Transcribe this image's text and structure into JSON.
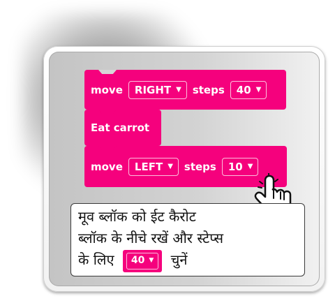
{
  "blocks": [
    {
      "keyword": "move",
      "direction": "RIGHT",
      "steps_label": "steps",
      "steps_value": "40"
    },
    {
      "action": "Eat carrot"
    },
    {
      "keyword": "move",
      "direction": "LEFT",
      "steps_label": "steps",
      "steps_value": "10"
    }
  ],
  "caret_glyph": "▼",
  "instruction": {
    "line1": "मूव ब्लॉक को ईट कैरोट",
    "line2": "ब्लॉक के नीचे रखें और स्टेप्स",
    "line3_before": "के लिए",
    "dropdown_value": "40",
    "line3_after": "चुनें"
  },
  "colors": {
    "block": "#f5017d",
    "panel": "#d3d3d3"
  },
  "icons": {
    "cursor": "pointing-hand-icon",
    "caret": "chevron-down-icon"
  }
}
